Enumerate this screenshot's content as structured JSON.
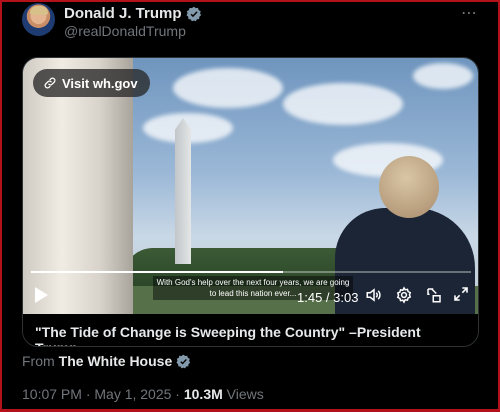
{
  "author": {
    "name": "Donald J. Trump",
    "handle": "@realDonaldTrump"
  },
  "media": {
    "visit_label": "Visit wh.gov",
    "caption": "With God's help over the next four years, we are going to lead this nation ever...",
    "time_display": "1:45 / 3:03",
    "progress_fraction": 0.573,
    "title": "\"The Tide of Change is Sweeping the Country\" –President Trump"
  },
  "source": {
    "prefix": "From",
    "name": "The White House"
  },
  "meta": {
    "timestamp": "10:07 PM · May 1, 2025 ·",
    "views_count": "10.3M",
    "views_label": "Views"
  },
  "colors": {
    "verified_blue": "#1d9bf0",
    "verified_gray": "#829aab",
    "muted_text": "#71767b"
  },
  "icons": [
    "verified-badge-icon",
    "more-icon",
    "link-icon",
    "play-icon",
    "volume-icon",
    "settings-icon",
    "popout-icon",
    "fullscreen-icon"
  ]
}
